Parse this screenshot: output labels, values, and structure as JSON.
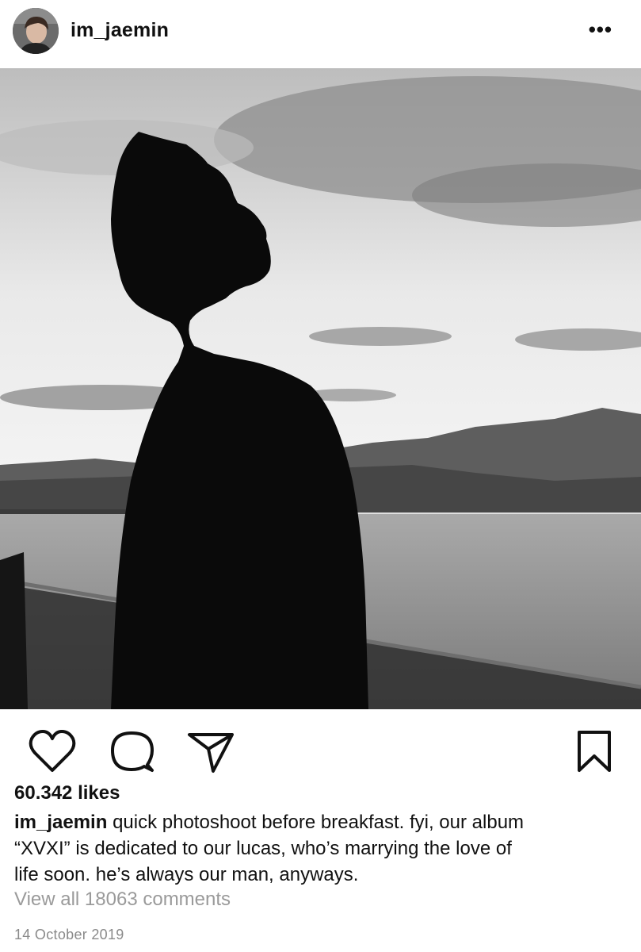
{
  "header": {
    "username": "im_jaemin",
    "more_label": "•••",
    "avatar_icon": "profile-avatar"
  },
  "post": {
    "image_subject": "silhouette-photo",
    "actions": {
      "like_icon": "heart-icon",
      "comment_icon": "comment-bubble-icon",
      "share_icon": "paper-plane-icon",
      "save_icon": "bookmark-icon"
    },
    "likes": "60.342 likes",
    "caption_username": "im_jaemin",
    "caption_lines": [
      "quick photoshoot before breakfast. fyi, our album",
      "“XVXI” is dedicated to our lucas, who’s marrying the love of",
      "life soon. he’s always our man, anyways."
    ],
    "view_comments": "View all 18063 comments",
    "date": "14 October 2019"
  },
  "colors": {
    "text": "#111111",
    "muted": "#9a9a9a",
    "date": "#8a8a8a"
  }
}
